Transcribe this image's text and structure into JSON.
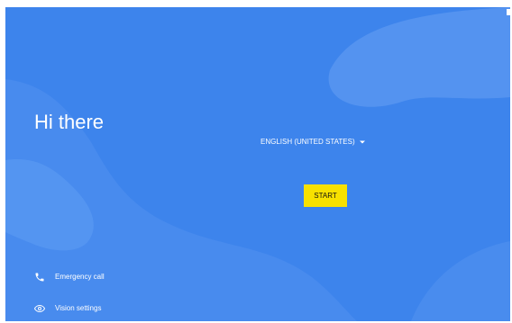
{
  "welcome": {
    "greeting": "Hi there",
    "language": "ENGLISH (UNITED STATES)",
    "start_label": "START"
  },
  "actions": {
    "emergency_label": "Emergency call",
    "vision_label": "Vision settings"
  },
  "icons": {
    "language": "caret-down-icon",
    "emergency": "phone-icon",
    "vision": "eye-icon"
  },
  "colors": {
    "background": "#3d84ec",
    "button": "#f7e100",
    "text": "#ffffff"
  }
}
